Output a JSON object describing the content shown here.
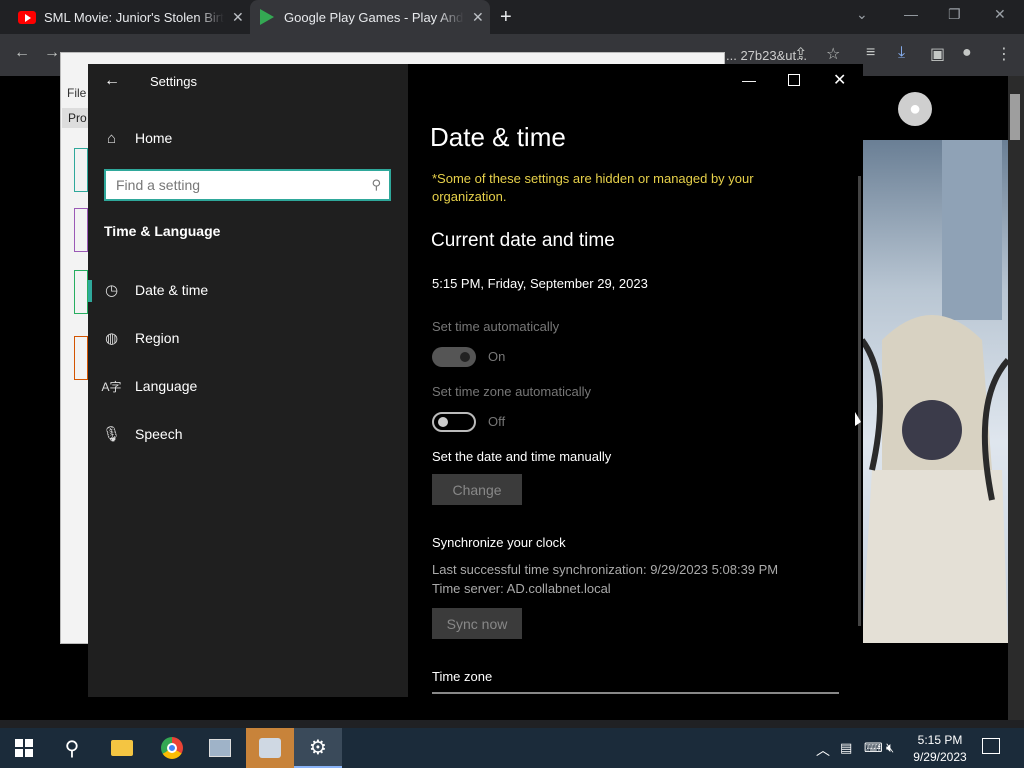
{
  "browser": {
    "tabs": [
      {
        "title": "SML Movie: Junior's Stolen Birthday",
        "icon": "youtube-icon"
      },
      {
        "title": "Google Play Games - Play Android Games on PC",
        "icon": "play-icon"
      }
    ],
    "address": "... 27b23&ut..."
  },
  "settings": {
    "window_title": "Settings",
    "home_label": "Home",
    "search_placeholder": "Find a setting",
    "section_title": "Time & Language",
    "nav": [
      {
        "label": "Date & time",
        "icon": "clock-calendar-icon",
        "selected": true
      },
      {
        "label": "Region",
        "icon": "globe-icon",
        "selected": false
      },
      {
        "label": "Language",
        "icon": "language-icon",
        "selected": false
      },
      {
        "label": "Speech",
        "icon": "microphone-icon",
        "selected": false
      }
    ],
    "page_title": "Date & time",
    "managed_notice": "*Some of these settings are hidden or managed by your organization.",
    "current_heading": "Current date and time",
    "current_value": "5:15 PM, Friday, September 29, 2023",
    "set_time_auto_label": "Set time automatically",
    "set_time_auto_state": "On",
    "set_tz_auto_label": "Set time zone automatically",
    "set_tz_auto_state": "Off",
    "manual_label": "Set the date and time manually",
    "change_button": "Change",
    "sync_heading": "Synchronize your clock",
    "sync_last": "Last successful time synchronization: 9/29/2023 5:08:39 PM",
    "sync_server": "Time server: AD.collabnet.local",
    "sync_button": "Sync now",
    "timezone_label": "Time zone"
  },
  "background_window": {
    "menu_item": "File",
    "tab_label": "Pro"
  },
  "taskbar": {
    "time": "5:15 PM",
    "date": "9/29/2023"
  },
  "colors": {
    "accent": "#2fa89b",
    "notice": "#e6d04a"
  }
}
